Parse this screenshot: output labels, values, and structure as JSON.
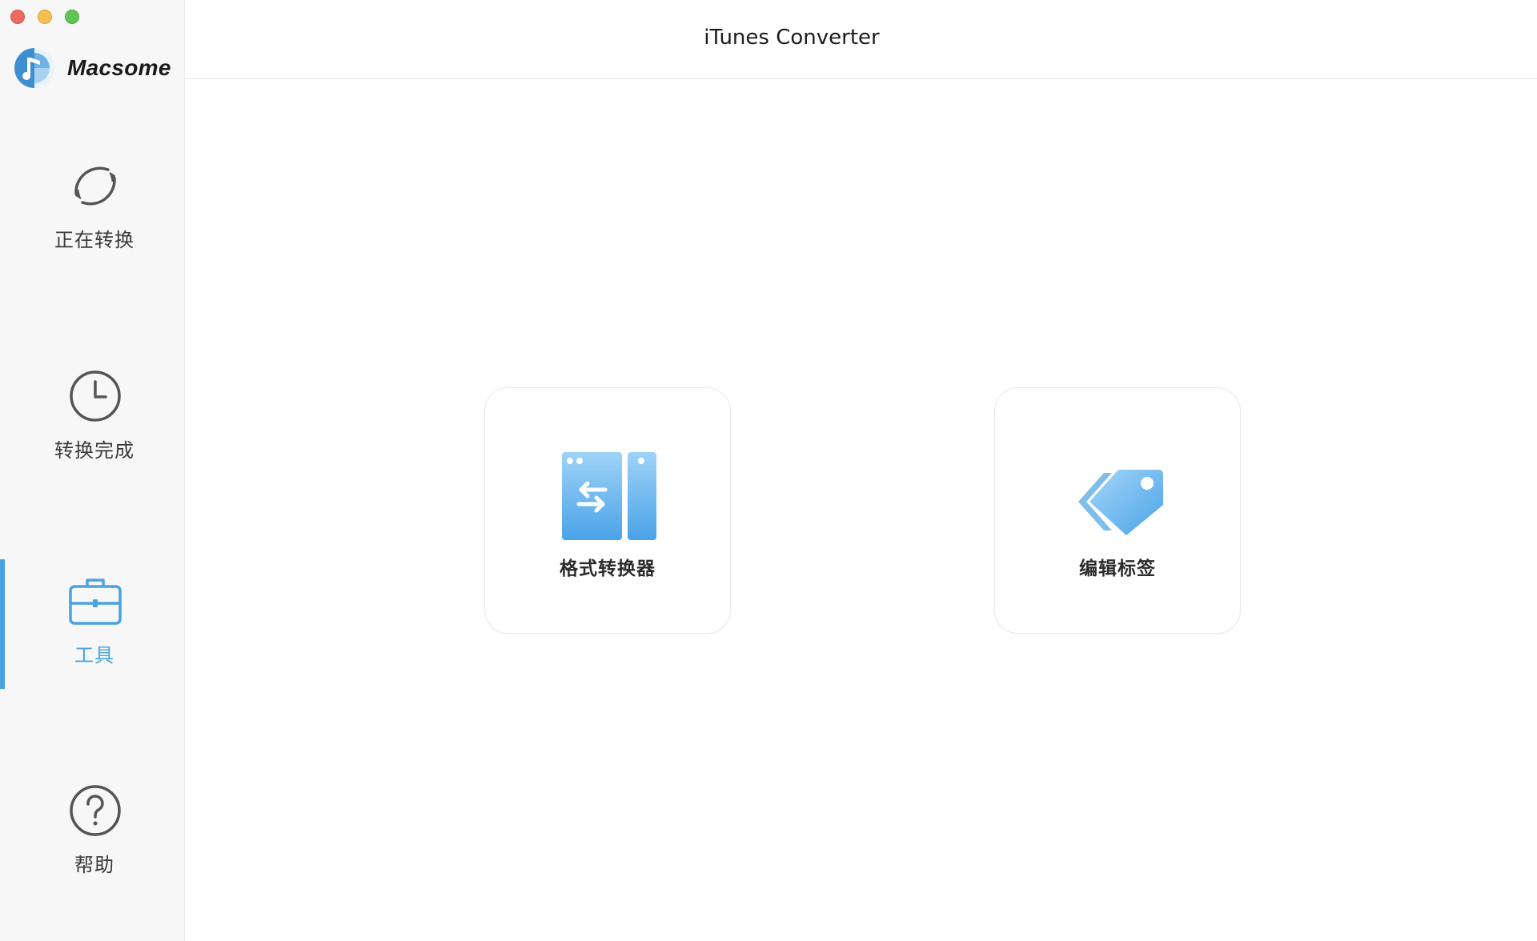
{
  "app": {
    "brand_name": "Macsome",
    "window_title": "iTunes Converter"
  },
  "sidebar": {
    "items": [
      {
        "label": "正在转换",
        "icon": "refresh-icon",
        "active": false
      },
      {
        "label": "转换完成",
        "icon": "clock-icon",
        "active": false
      },
      {
        "label": "工具",
        "icon": "toolbox-icon",
        "active": true
      },
      {
        "label": "帮助",
        "icon": "help-icon",
        "active": false
      }
    ]
  },
  "tools": [
    {
      "label": "格式转换器",
      "icon": "format-converter-icon"
    },
    {
      "label": "编辑标签",
      "icon": "tag-icon"
    }
  ],
  "colors": {
    "accent": "#4aa3e0",
    "icon_gray": "#555555"
  }
}
